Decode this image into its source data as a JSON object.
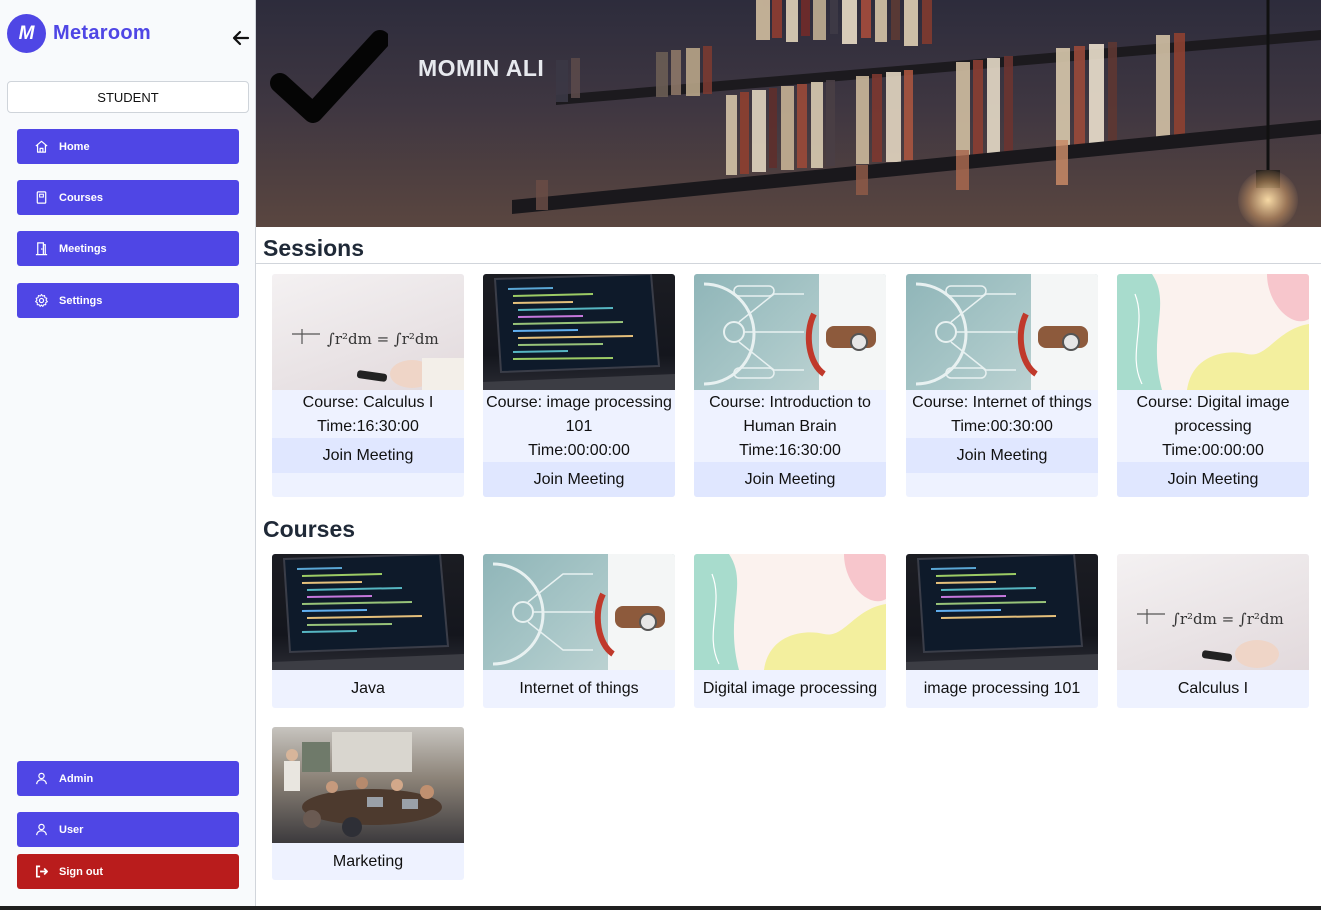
{
  "brand": {
    "logo_letter": "M",
    "name": "Metaroom",
    "accent_color": "#4f46e5"
  },
  "sidebar": {
    "role": "STUDENT",
    "nav": [
      {
        "label": "Home",
        "icon": "home-icon"
      },
      {
        "label": "Courses",
        "icon": "book-icon"
      },
      {
        "label": "Meetings",
        "icon": "door-icon"
      },
      {
        "label": "Settings",
        "icon": "gear-icon"
      }
    ],
    "bottom": [
      {
        "label": "Admin",
        "icon": "user-icon"
      },
      {
        "label": "User",
        "icon": "user-icon"
      },
      {
        "label": "Sign out",
        "icon": "sign-out-icon",
        "color": "#b91c1c"
      }
    ]
  },
  "header": {
    "user_name": "MOMIN ALI"
  },
  "sessions": {
    "title": "Sessions",
    "join_label": "Join Meeting",
    "items": [
      {
        "course": "Course: Calculus I",
        "time": "Time:16:30:00",
        "thumb": "whiteboard"
      },
      {
        "course": "Course: image processing 101",
        "time": "Time:00:00:00",
        "thumb": "code-laptop"
      },
      {
        "course": "Course: Introduction to Human Brain",
        "time": "Time:16:30:00",
        "thumb": "medical-infographic"
      },
      {
        "course": "Course: Internet of things",
        "time": "Time:00:30:00",
        "thumb": "medical-infographic"
      },
      {
        "course": "Course: Digital image processing",
        "time": "Time:00:00:00",
        "thumb": "pastel-shapes"
      }
    ]
  },
  "courses": {
    "title": "Courses",
    "items": [
      {
        "name": "Java",
        "thumb": "code-laptop"
      },
      {
        "name": "Internet of things",
        "thumb": "medical-infographic"
      },
      {
        "name": "Digital image processing",
        "thumb": "pastel-shapes"
      },
      {
        "name": "image processing 101",
        "thumb": "code-laptop"
      },
      {
        "name": "Calculus I",
        "thumb": "whiteboard"
      },
      {
        "name": "Marketing",
        "thumb": "meeting-room"
      }
    ]
  }
}
